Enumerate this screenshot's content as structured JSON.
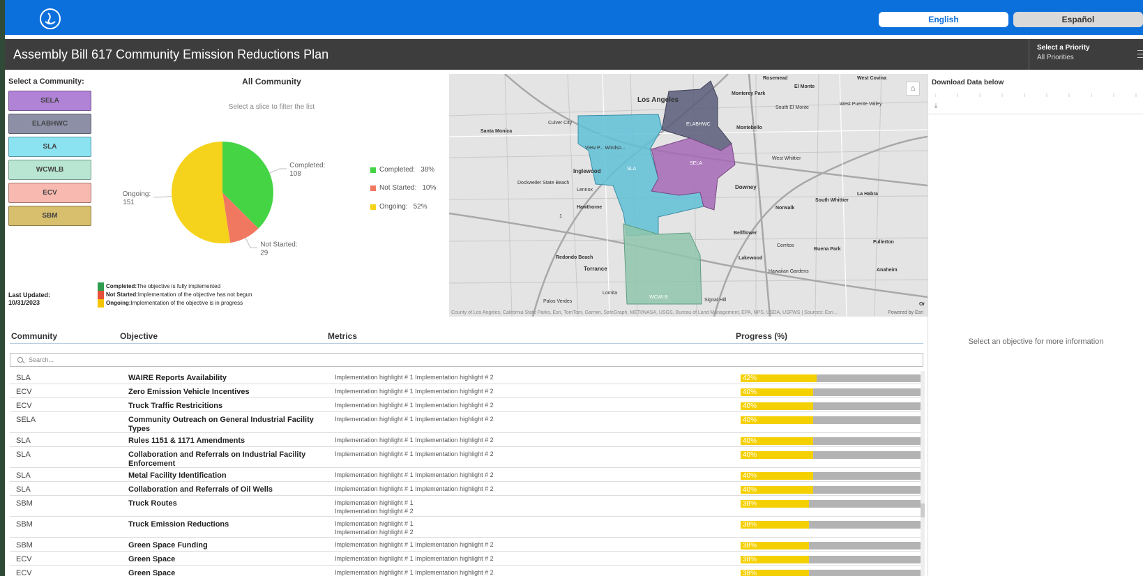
{
  "header": {
    "lang_en": "English",
    "lang_es": "Español",
    "title": "Assembly Bill 617 Community Emission Reductions Plan",
    "priority_label": "Select a Priority",
    "priority_value": "All Priorities",
    "brand_color": "#0b6fdc"
  },
  "sidebar": {
    "label": "Select a Community:",
    "communities": [
      {
        "label": "SELA",
        "color": "#b083d6"
      },
      {
        "label": "ELABHWC",
        "color": "#8d8fa6"
      },
      {
        "label": "SLA",
        "color": "#8be3f2"
      },
      {
        "label": "WCWLB",
        "color": "#b9e6d3"
      },
      {
        "label": "ECV",
        "color": "#f8b9b0"
      },
      {
        "label": "SBM",
        "color": "#d8bf6e"
      }
    ],
    "updated_label": "Last Updated:",
    "updated_value": "10/31/2023"
  },
  "chart": {
    "title": "All Community",
    "subtitle": "Select a slice to filter the list",
    "label_completed": "Completed:",
    "label_completed_val": "108",
    "label_not_started": "Not Started:",
    "label_not_started_val": "29",
    "label_ongoing": "Ongoing:",
    "label_ongoing_val": "151",
    "legend": [
      {
        "name": "Completed:",
        "pct": "38%",
        "color": "#44d444"
      },
      {
        "name": "Not Started:",
        "pct": "10%",
        "color": "#f07860"
      },
      {
        "name": "Ongoing:",
        "pct": "52%",
        "color": "#f5d31c"
      }
    ],
    "definitions": [
      {
        "term": "Completed:",
        "text": " The objective is fully implemented",
        "color": "#2e9e4e"
      },
      {
        "term": "Not Started:",
        "text": " Implementation of the objective has not begun",
        "color": "#e8503a"
      },
      {
        "term": "Ongoing:",
        "text": " Implementation of the objective is in progress",
        "color": "#f5c400"
      }
    ]
  },
  "chart_data": {
    "type": "pie",
    "title": "All Community",
    "categories": [
      "Completed",
      "Not Started",
      "Ongoing"
    ],
    "values": [
      108,
      29,
      151
    ],
    "colors": [
      "#44d444",
      "#f07860",
      "#f5d31c"
    ]
  },
  "map": {
    "labels": {
      "los_angeles": "Los Angeles",
      "santa_monica": "Santa Monica",
      "culver_city": "Culver City",
      "inglewood": "Inglewood",
      "lennox": "Lennox",
      "hawthorne": "Hawthorne",
      "redondo": "Redondo Beach",
      "torrance": "Torrance",
      "lomita": "Lomita",
      "rosemead": "Rosemead",
      "el_monte": "El Monte",
      "west_covina": "West Covina",
      "monterey_park": "Monterey Park",
      "south_el_monte": "South El Monte",
      "west_puente": "West Puente Valley",
      "montebello": "Montebello",
      "west_whittier": "West Whittier",
      "downey": "Downey",
      "south_whittier": "South Whittier",
      "la_habra": "La Habra",
      "norwalk": "Norwalk",
      "bellflower": "Bellflower",
      "cerritos": "Cerritos",
      "buena_park": "Buena Park",
      "fullerton": "Fullerton",
      "lakewood": "Lakewood",
      "hawaiian_gardens": "Hawaiian Gardens",
      "anaheim": "Anaheim",
      "signal_hill": "Signal Hill",
      "palos_verdes": "Palos Verdes",
      "dockweiler": "Dockweiler State Beach",
      "view_park": "View P... Windso...",
      "elabhwc": "ELABHWC",
      "sela": "SELA",
      "sla": "SLA",
      "wcwlb": "WCWLB",
      "route_1": "1",
      "or_edge": "Or"
    },
    "attribution": "County of Los Angeles, California State Parks, Esri, TomTom, Garmin, SafeGraph, METI/NASA, USGS, Bureau of Land Management, EPA, NPS, USDA, USFWS | Sources: Esri...",
    "powered": "Powered by Esri"
  },
  "right": {
    "download_label": "Download Data below",
    "info_message": "Select an objective for more information"
  },
  "table": {
    "headers": {
      "community": "Community",
      "objective": "Objective",
      "metrics": "Metrics",
      "progress": "Progress (%)"
    },
    "search_placeholder": "Search...",
    "rows": [
      {
        "community": "SLA",
        "objective": "WAIRE Reports Availability",
        "metrics": [
          "Implementation highlight # 1 Implementation highlight # 2"
        ],
        "progress": 42,
        "pct_label": "42%"
      },
      {
        "community": "ECV",
        "objective": "Zero Emission Vehicle Incentives",
        "metrics": [
          "Implementation highlight # 1 Implementation highlight # 2"
        ],
        "progress": 40,
        "pct_label": "40%"
      },
      {
        "community": "ECV",
        "objective": "Truck Traffic Restricitions",
        "metrics": [
          "Implementation highlight # 1 Implementation highlight # 2"
        ],
        "progress": 40,
        "pct_label": "40%"
      },
      {
        "community": "SELA",
        "objective": "Community Outreach on General Industrial Facility Types",
        "metrics": [
          "Implementation highlight # 1 Implementation highlight # 2"
        ],
        "progress": 40,
        "pct_label": "40%"
      },
      {
        "community": "SLA",
        "objective": "Rules 1151 & 1171 Amendments",
        "metrics": [
          "Implementation highlight # 1 Implementation highlight # 2"
        ],
        "progress": 40,
        "pct_label": "40%"
      },
      {
        "community": "SLA",
        "objective": "Collaboration and Referrals on Industrial Facility Enforcement",
        "metrics": [
          "Implementation highlight # 1 Implementation highlight # 2"
        ],
        "progress": 40,
        "pct_label": "40%"
      },
      {
        "community": "SLA",
        "objective": "Metal Facility Identification",
        "metrics": [
          "Implementation highlight # 1 Implementation highlight # 2"
        ],
        "progress": 40,
        "pct_label": "40%"
      },
      {
        "community": "SLA",
        "objective": "Collaboration and Referrals of Oil Wells",
        "metrics": [
          "Implementation highlight # 1 Implementation highlight # 2"
        ],
        "progress": 40,
        "pct_label": "40%"
      },
      {
        "community": "SBM",
        "objective": "Truck Routes",
        "metrics": [
          "Implementation highlight # 1",
          "Implementation highlight # 2"
        ],
        "progress": 38,
        "pct_label": "38%"
      },
      {
        "community": "SBM",
        "objective": "Truck Emission Reductions",
        "metrics": [
          "Implementation highlight # 1",
          "Implementation highlight # 2"
        ],
        "progress": 38,
        "pct_label": "38%"
      },
      {
        "community": "SBM",
        "objective": "Green Space Funding",
        "metrics": [
          "Implementation highlight # 1 Implementation highlight # 2"
        ],
        "progress": 38,
        "pct_label": "38%"
      },
      {
        "community": "ECV",
        "objective": "Green Space",
        "metrics": [
          "Implementation highlight # 1 Implementation highlight # 2"
        ],
        "progress": 38,
        "pct_label": "38%"
      },
      {
        "community": "ECV",
        "objective": "Green Space",
        "metrics": [
          "Implementation highlight # 1 Implementation highlight # 2"
        ],
        "progress": 38,
        "pct_label": "38%"
      }
    ]
  }
}
